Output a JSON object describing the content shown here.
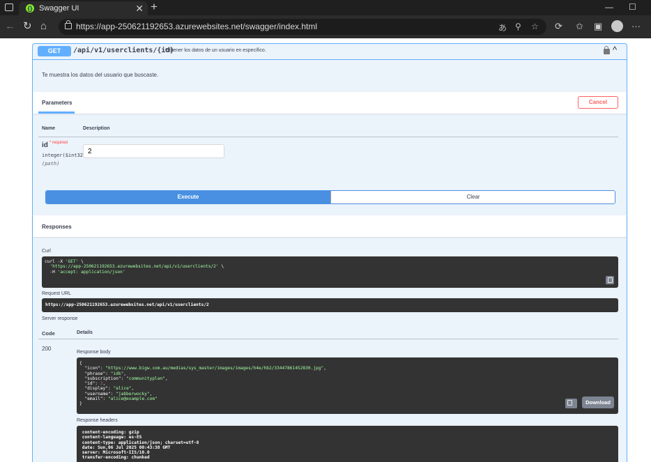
{
  "browser": {
    "tab_title": "Swagger UI",
    "tab_close": "✕",
    "new_tab": "+",
    "url": "https://app-250621192653.azurewebsites.net/swagger/index.html",
    "icons": [
      "tab-actions-icon",
      "back-icon",
      "refresh-icon",
      "home-icon",
      "lock-icon",
      "read-aloud-icon",
      "zoom-icon",
      "favorite-icon",
      "extensions-icon",
      "favorites-icon",
      "collections-icon",
      "profile-icon",
      "more-icon",
      "minimize-icon",
      "maximize-icon"
    ]
  },
  "operation": {
    "method": "GET",
    "path": "/api/v1/userclients/{id}",
    "summary": "Obtener los datos de un usuario en específico.",
    "description": "Te muestra los datos del usuario que buscaste.",
    "parameters_tab": "Parameters",
    "cancel_label": "Cancel",
    "col_name": "Name",
    "col_description": "Description",
    "param": {
      "name": "id",
      "required": "* required",
      "type": "integer($int32)",
      "in": "(path)",
      "value": "2"
    },
    "execute_label": "Execute",
    "clear_label": "Clear"
  },
  "responses": {
    "title": "Responses",
    "curl_label": "Curl",
    "curl_line1": "curl -X ",
    "curl_line1_method": "'GET'",
    "curl_line1_tail": " \\",
    "curl_line2_indent": "  ",
    "curl_line2_url": "'https://app-250621192653.azurewebsites.net/api/v1/userclients/2'",
    "curl_line2_tail": " \\",
    "curl_line3": "  -H ",
    "curl_line3_header": "'accept: application/json'",
    "request_url_label": "Request URL",
    "request_url": "https://app-250621192653.azurewebsites.net/api/v1/userclients/2",
    "server_response_label": "Server response",
    "code_label": "Code",
    "details_label": "Details",
    "code": "200",
    "response_body_label": "Response body",
    "body": {
      "open": "{",
      "icon_key": "  \"icon\": ",
      "icon_val": "\"https://www.bigw.com.au/medias/sys_master/images/images/h4e/hb2/33447861452830.jpg\"",
      "phrase_key": "  \"phrase\": ",
      "phrase_val": "\"idk\"",
      "subscription_key": "  \"subscription\": ",
      "subscription_val": "\"communityplan\"",
      "id_key": "  \"id\": ",
      "id_val": "2",
      "display_key": "  \"display\": ",
      "display_val": "\"alice\"",
      "username_key": "  \"username\": ",
      "username_val": "\"jabberwocky\"",
      "email_key": "  \"email\": ",
      "email_val": "\"alice@example.com\"",
      "comma": ",",
      "close": "}"
    },
    "download_label": "Download",
    "response_headers_label": "Response headers",
    "headers": [
      " content-encoding: gzip",
      " content-language: es-ES",
      " content-type: application/json; charset=utf-8",
      " date: Sun,06 Jul 2025 00:43:38 GMT",
      " server: Microsoft-IIS/10.0",
      " transfer-encoding: chunked"
    ]
  }
}
